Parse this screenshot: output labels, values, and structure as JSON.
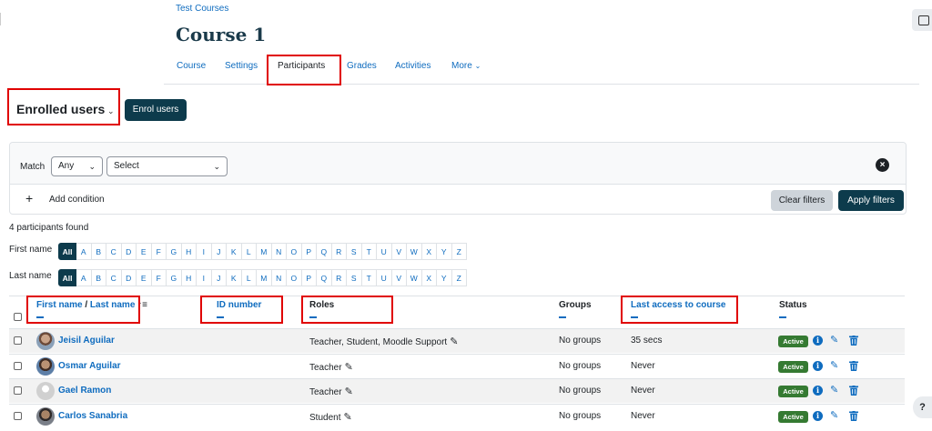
{
  "breadcrumb": "Test Courses",
  "course_title": "Course 1",
  "nav_tabs": [
    "Course",
    "Settings",
    "Participants",
    "Grades",
    "Activities",
    "More"
  ],
  "nav_active": "Participants",
  "page_heading": "Enrolled users",
  "enrol_button": "Enrol users",
  "filter": {
    "match_label": "Match",
    "match_value": "Any",
    "select_value": "Select",
    "add_condition": "Add condition",
    "clear_button": "Clear filters",
    "apply_button": "Apply filters"
  },
  "participants_found": "4 participants found",
  "initials": {
    "first_name_label": "First name",
    "last_name_label": "Last name",
    "all_label": "All",
    "letters": [
      "A",
      "B",
      "C",
      "D",
      "E",
      "F",
      "G",
      "H",
      "I",
      "J",
      "K",
      "L",
      "M",
      "N",
      "O",
      "P",
      "Q",
      "R",
      "S",
      "T",
      "U",
      "V",
      "W",
      "X",
      "Y",
      "Z"
    ]
  },
  "table": {
    "headers": {
      "first_name": "First name",
      "separator": " / ",
      "last_name": "Last name",
      "id_number": "ID number",
      "roles": "Roles",
      "groups": "Groups",
      "last_access": "Last access to course",
      "status": "Status"
    },
    "rows": [
      {
        "name": "Jeisil Aguilar",
        "roles": "Teacher, Student, Moodle Support",
        "groups": "No groups",
        "last_access": "35 secs",
        "status": "Active"
      },
      {
        "name": "Osmar Aguilar",
        "roles": "Teacher",
        "groups": "No groups",
        "last_access": "Never",
        "status": "Active"
      },
      {
        "name": "Gael Ramon",
        "roles": "Teacher",
        "groups": "No groups",
        "last_access": "Never",
        "status": "Active"
      },
      {
        "name": "Carlos Sanabria",
        "roles": "Student",
        "groups": "No groups",
        "last_access": "Never",
        "status": "Active"
      }
    ]
  },
  "help_label": "?",
  "colors": {
    "link": "#0f6cbf",
    "primary_dark": "#0d3b4c",
    "active_badge": "#357a32",
    "highlight_box": "#e00000"
  }
}
